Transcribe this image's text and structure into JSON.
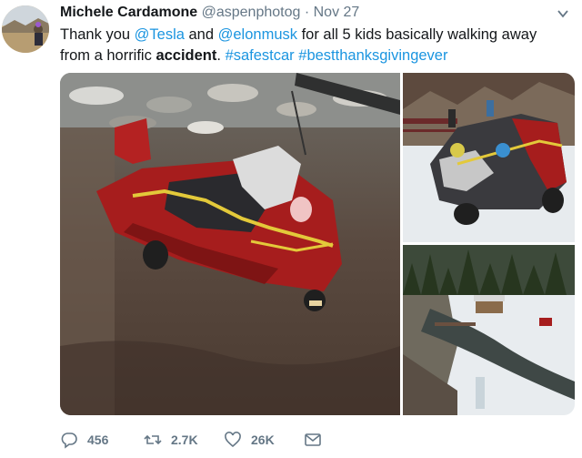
{
  "tweet": {
    "author_name": "Michele Cardamone",
    "author_handle": "@aspenphotog",
    "separator": " · ",
    "timestamp": "Nov 27",
    "text": {
      "part1": "Thank you ",
      "mention1": "@Tesla",
      "part2": " and ",
      "mention2": "@elonmusk",
      "part3": " for all 5 kids basically walking away from a horrific ",
      "bold_word": "accident",
      "part4": ". ",
      "hashtag1": "#safestcar",
      "part5": "  ",
      "hashtag2": "#bestthanksgivingever"
    }
  },
  "actions": {
    "reply_count": "456",
    "retweet_count": "2.7K",
    "like_count": "26K"
  },
  "icons": {
    "reply": "reply-icon",
    "retweet": "retweet-icon",
    "like": "heart-icon",
    "dm": "mail-icon",
    "menu": "chevron-down-icon"
  },
  "colors": {
    "link": "#1b95e0",
    "muted": "#657786",
    "text": "#14171a"
  }
}
